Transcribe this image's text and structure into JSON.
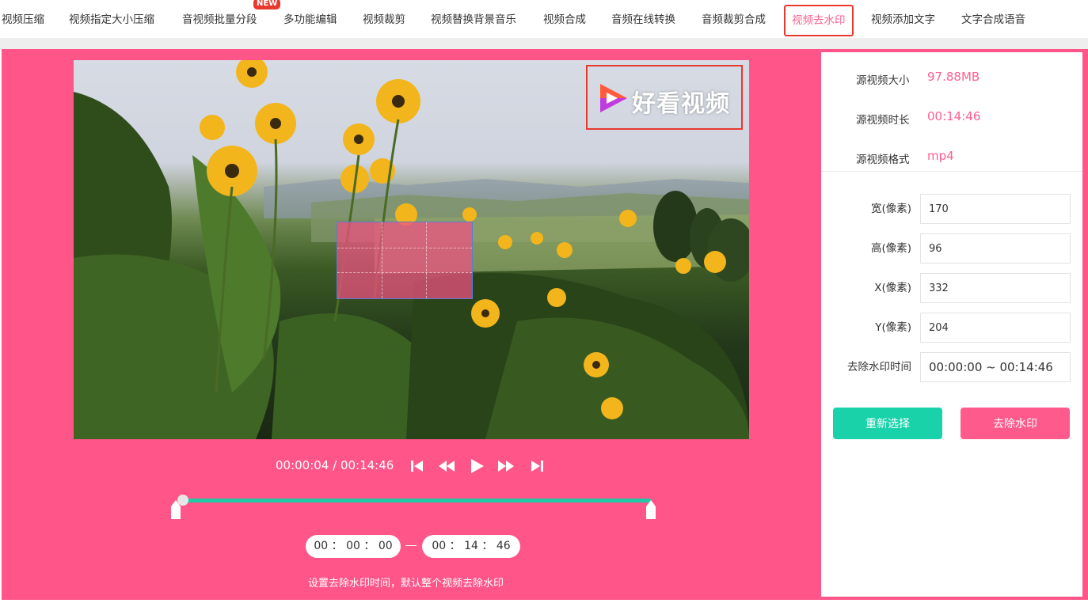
{
  "nav": {
    "items": [
      {
        "label": "视频压缩"
      },
      {
        "label": "视频指定大小压缩"
      },
      {
        "label": "音视频批量分段"
      },
      {
        "label": "多功能编辑"
      },
      {
        "label": "视频裁剪"
      },
      {
        "label": "视频替换背景音乐"
      },
      {
        "label": "视频合成"
      },
      {
        "label": "音频在线转换"
      },
      {
        "label": "音频裁剪合成"
      },
      {
        "label": "视频去水印",
        "active": true
      },
      {
        "label": "视频添加文字"
      },
      {
        "label": "文字合成语音"
      }
    ],
    "new_badge": "NEW"
  },
  "video": {
    "watermark_text": "好看视频"
  },
  "player": {
    "time_readout": "00:00:04 / 00:14:46",
    "progress": 0.0045
  },
  "range": {
    "start": {
      "h": "00",
      "m": "00",
      "s": "00"
    },
    "end": {
      "h": "00",
      "m": "14",
      "s": "46"
    },
    "sep": "："
  },
  "hint": "设置去除水印时间，默认整个视频去除水印",
  "info": {
    "size_label": "源视频大小",
    "size_value": "97.88MB",
    "duration_label": "源视频时长",
    "duration_value": "00:14:46",
    "format_label": "源视频格式",
    "format_value": "mp4"
  },
  "fields": {
    "width_label": "宽(像素)",
    "width_value": "170",
    "height_label": "高(像素)",
    "height_value": "96",
    "x_label": "X(像素)",
    "x_value": "332",
    "y_label": "Y(像素)",
    "y_value": "204",
    "time_label": "去除水印时间",
    "time_value": "00:00:00 ~ 00:14:46"
  },
  "buttons": {
    "reselect": "重新选择",
    "remove": "去除水印"
  },
  "colors": {
    "accent_pink": "#ff5589",
    "accent_green": "#19d2aa",
    "highlight_red": "#e8392f"
  }
}
